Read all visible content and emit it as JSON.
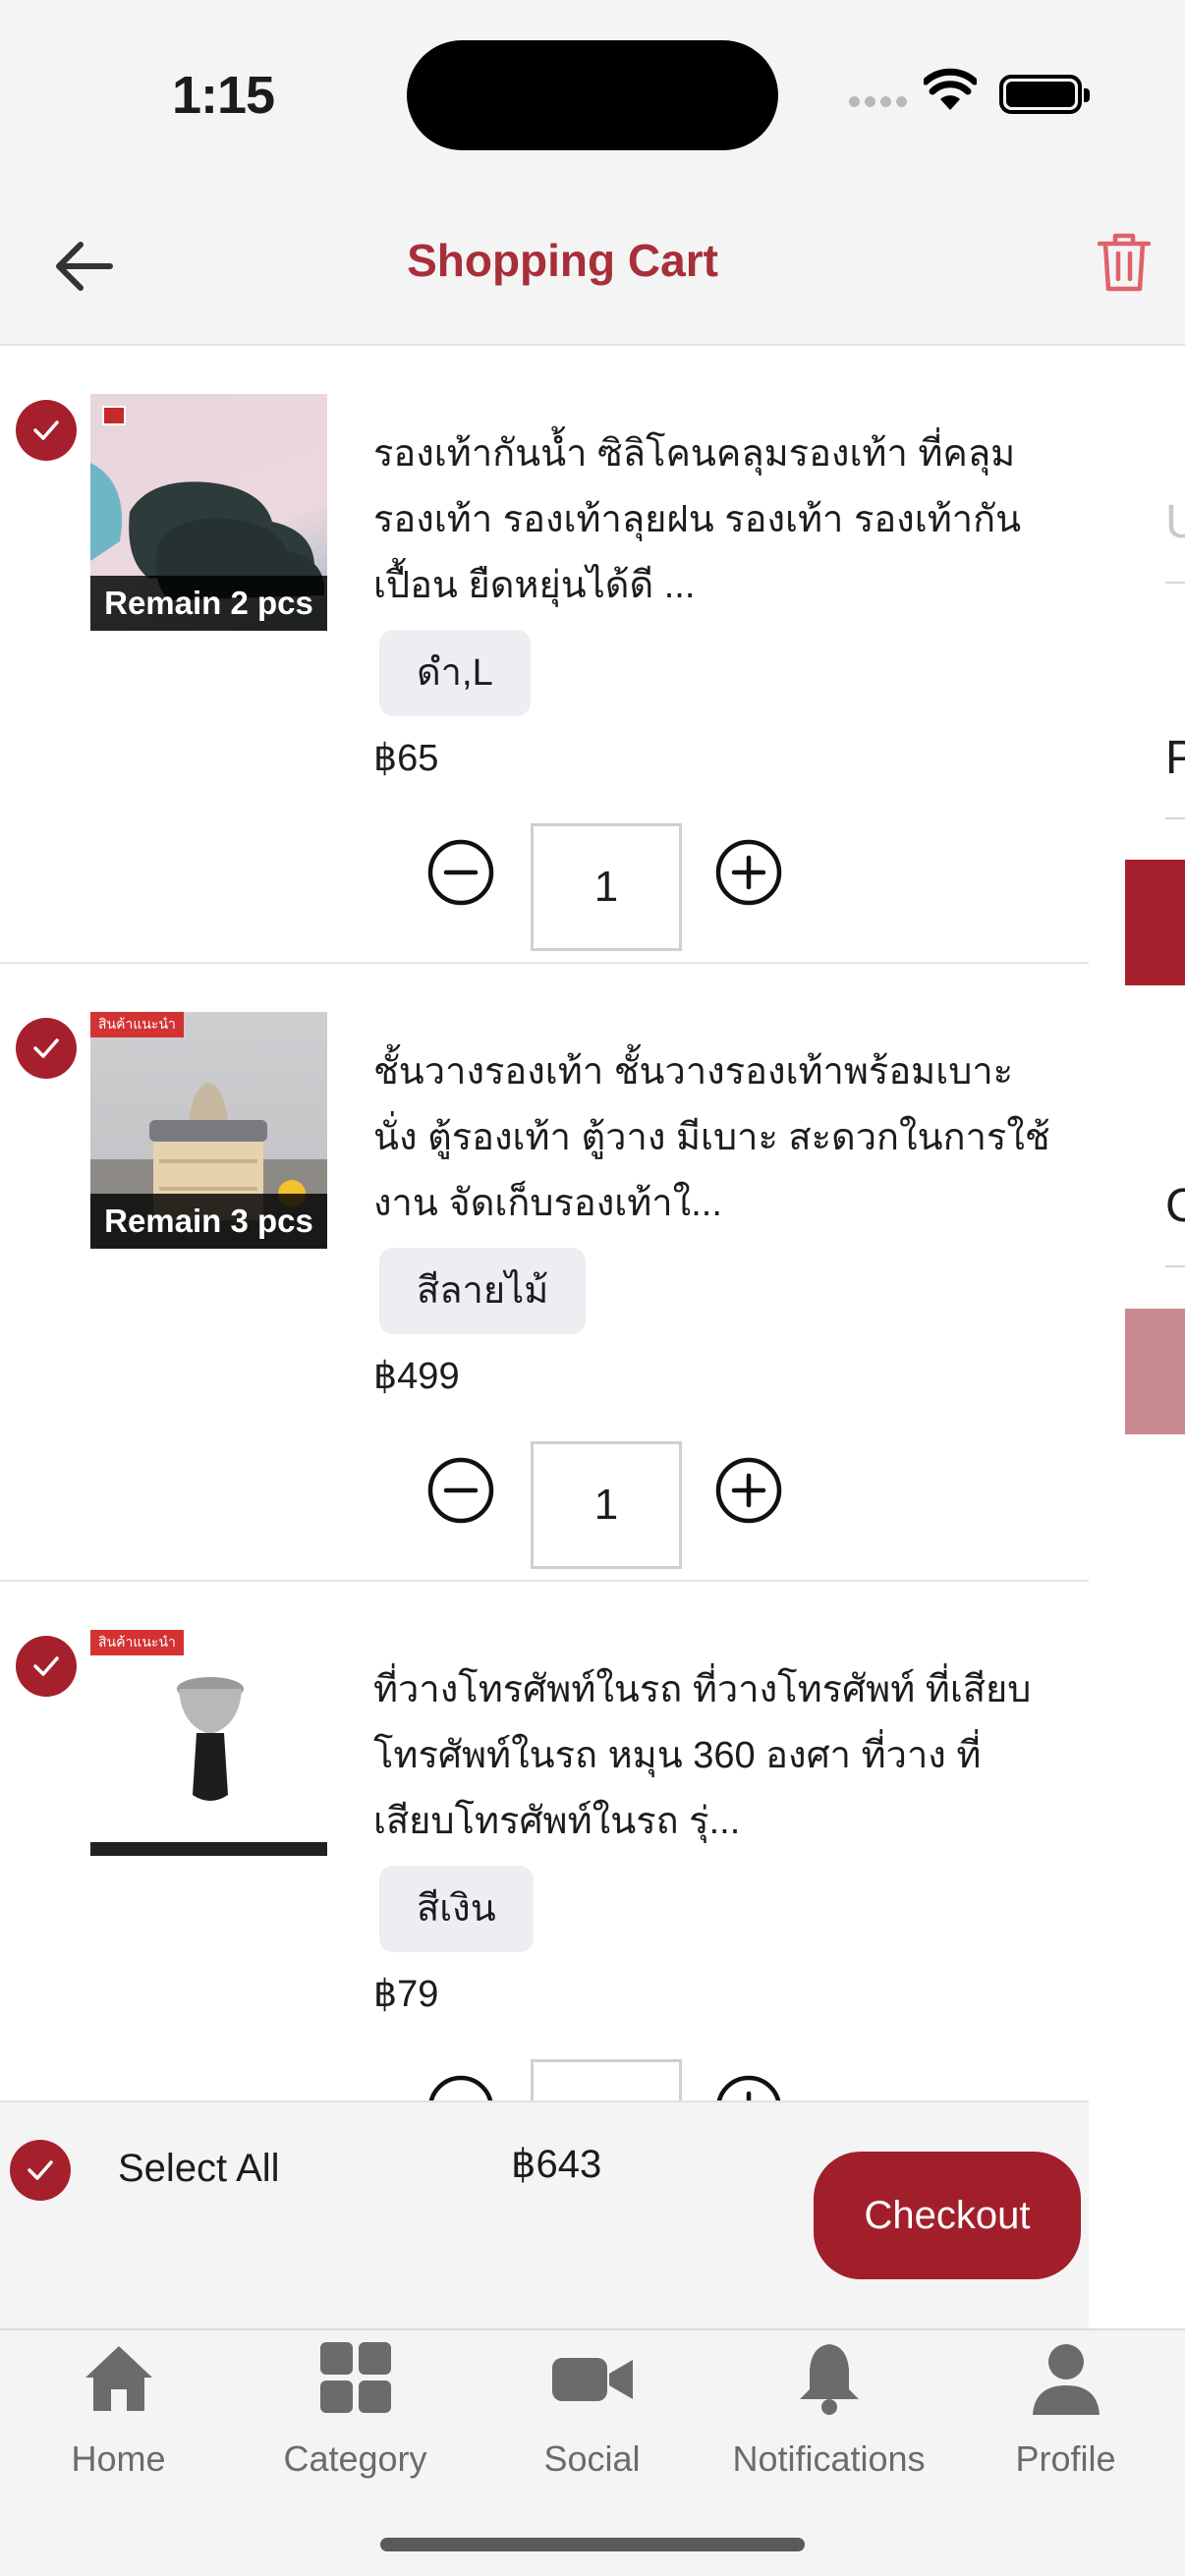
{
  "status_bar": {
    "time": "1:15"
  },
  "header": {
    "title": "Shopping Cart"
  },
  "cart": {
    "items": [
      {
        "name": "รองเท้ากันน้ำ ซิลิโคนคลุมรองเท้า ที่คลุมรองเท้า รองเท้าลุยฝน รองเท้า รองเท้ากันเปื้อน ยืดหยุ่นได้ดี ...",
        "remain": "Remain 2 pcs",
        "variant": "ดำ,L",
        "price": "฿65",
        "quantity": "1"
      },
      {
        "name": "ชั้นวางรองเท้า ชั้นวางรองเท้าพร้อมเบาะนั่ง ตู้รองเท้า ตู้วาง มีเบาะ สะดวกในการใช้งาน จัดเก็บรองเท้าใ...",
        "remain": "Remain 3 pcs",
        "variant": "สีลายไม้",
        "price": "฿499",
        "quantity": "1"
      },
      {
        "name": "ที่วางโทรศัพท์ในรถ ที่วางโทรศัพท์ ที่เสียบโทรศัพท์ในรถ หมุน 360 องศา ที่วาง ที่เสียบโทรศัพท์ในรถ รุ่...",
        "remain": "",
        "variant": "สีเงิน",
        "price": "฿79",
        "quantity": ""
      }
    ]
  },
  "side_panel": {
    "labels": [
      "U",
      "P",
      "C"
    ]
  },
  "checkout_bar": {
    "select_all_label": "Select All",
    "total": "฿643",
    "checkout_label": "Checkout"
  },
  "tabs": [
    {
      "label": "Home",
      "icon": "home-icon"
    },
    {
      "label": "Category",
      "icon": "grid-icon"
    },
    {
      "label": "Social",
      "icon": "video-camera-icon"
    },
    {
      "label": "Notifications",
      "icon": "bell-icon"
    },
    {
      "label": "Profile",
      "icon": "person-icon"
    }
  ],
  "colors": {
    "accent": "#a5202c",
    "title": "#a72f3a",
    "background": "#f4f4f4"
  }
}
